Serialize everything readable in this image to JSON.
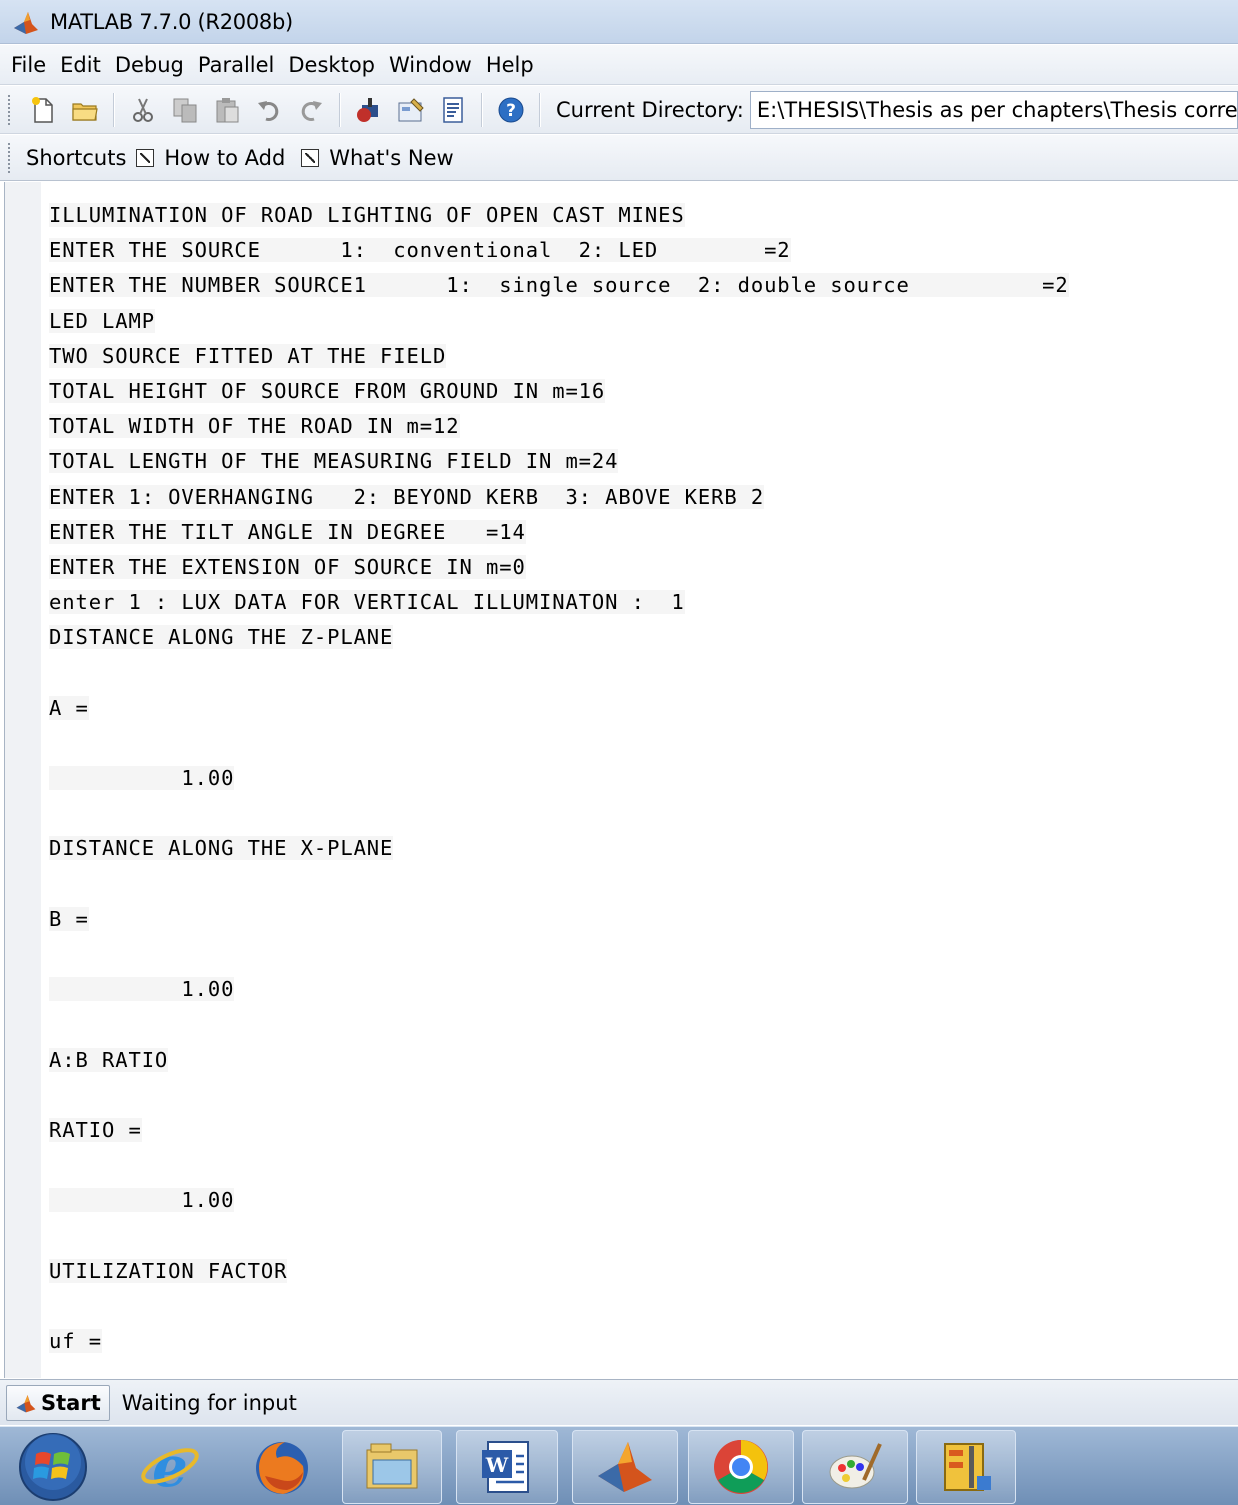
{
  "window": {
    "title": "MATLAB  7.7.0 (R2008b)"
  },
  "menu": [
    "File",
    "Edit",
    "Debug",
    "Parallel",
    "Desktop",
    "Window",
    "Help"
  ],
  "toolbar": {
    "current_directory_label": "Current Directory:",
    "current_directory_value": "E:\\THESIS\\Thesis as per chapters\\Thesis correction a"
  },
  "shortcuts": {
    "label": "Shortcuts",
    "links": [
      "How to Add",
      "What's New"
    ]
  },
  "console": {
    "lines": [
      "ILLUMINATION OF ROAD LIGHTING OF OPEN CAST MINES",
      "ENTER THE SOURCE      1:  conventional  2: LED        =2",
      "ENTER THE NUMBER SOURCE1      1:  single source  2: double source          =2",
      "LED LAMP",
      "TWO SOURCE FITTED AT THE FIELD",
      "TOTAL HEIGHT OF SOURCE FROM GROUND IN m=16",
      "TOTAL WIDTH OF THE ROAD IN m=12",
      "TOTAL LENGTH OF THE MEASURING FIELD IN m=24",
      "ENTER 1: OVERHANGING   2: BEYOND KERB  3: ABOVE KERB 2",
      "ENTER THE TILT ANGLE IN DEGREE   =14",
      "ENTER THE EXTENSION OF SOURCE IN m=0",
      "enter 1 : LUX DATA FOR VERTICAL ILLUMINATON :  1",
      "DISTANCE ALONG THE Z-PLANE",
      "",
      "A =",
      "",
      "          1.00",
      "",
      "DISTANCE ALONG THE X-PLANE",
      "",
      "B =",
      "",
      "          1.00",
      "",
      "A:B RATIO",
      "",
      "RATIO =",
      "",
      "          1.00",
      "",
      "UTILIZATION FACTOR",
      "",
      "uf ="
    ]
  },
  "statusbar": {
    "start_label": "Start",
    "status_text": "Waiting for input"
  },
  "taskbar": {
    "apps": [
      "internet-explorer-icon",
      "firefox-icon",
      "explorer-icon",
      "word-icon",
      "matlab-icon",
      "chrome-icon",
      "paint-icon",
      "archive-icon"
    ]
  },
  "colors": {
    "titlebar": "#c9d8ec",
    "taskbar": "#7f9cc2",
    "matlab_orange": "#e0621b"
  }
}
